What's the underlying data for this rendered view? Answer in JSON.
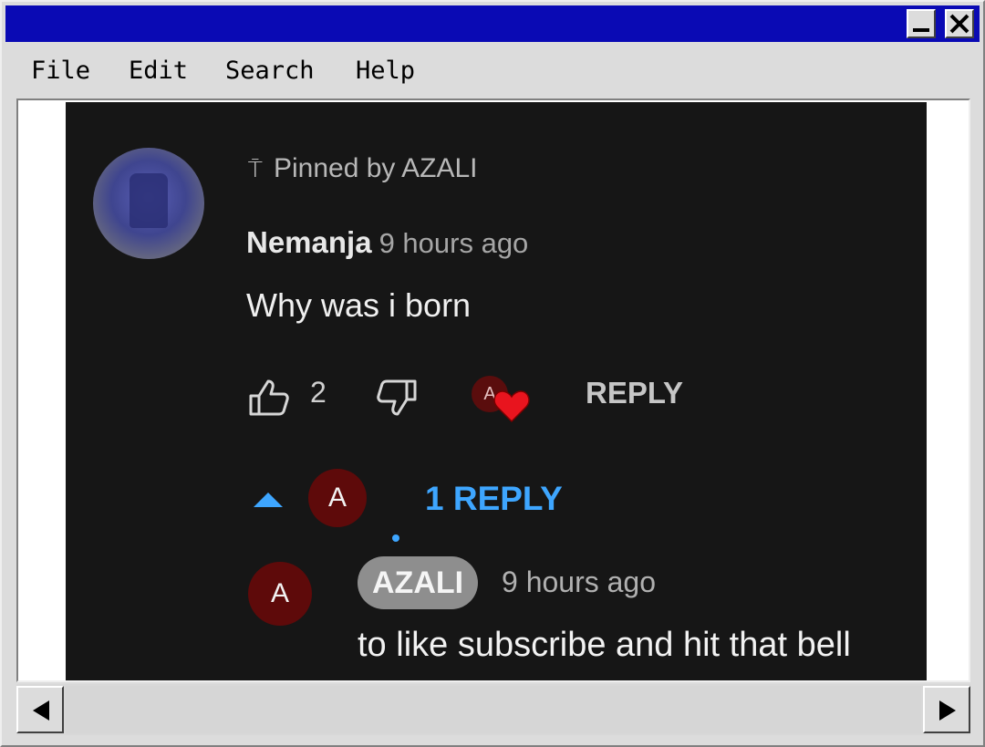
{
  "menu": {
    "file": "File",
    "edit": "Edit",
    "search": "Search",
    "help": "Help"
  },
  "comment": {
    "pinned_label": "Pinned by AZALI",
    "author": "Nemanja",
    "time": "9 hours ago",
    "text": "Why was i born",
    "like_count": "2",
    "creator_heart_letter": "A",
    "reply_label": "REPLY",
    "replies_avatar_letter": "A",
    "replies_link": "1 REPLY"
  },
  "reply": {
    "avatar_letter": "A",
    "author": "AZALI",
    "time": "9 hours ago",
    "text": "to like subscribe and hit that bell"
  },
  "icons": {
    "pin": "pin-icon",
    "like": "thumbs-up-icon",
    "dislike": "thumbs-down-icon",
    "heart": "heart-icon",
    "caret": "caret-up-icon",
    "minimize": "minimize-icon",
    "close": "close-icon",
    "scroll_left": "arrow-left-icon",
    "scroll_right": "arrow-right-icon"
  },
  "colors": {
    "title_bar": "#0a0ab4",
    "link_blue": "#3ea6ff",
    "heart_red": "#e8141e",
    "background": "#161616"
  }
}
